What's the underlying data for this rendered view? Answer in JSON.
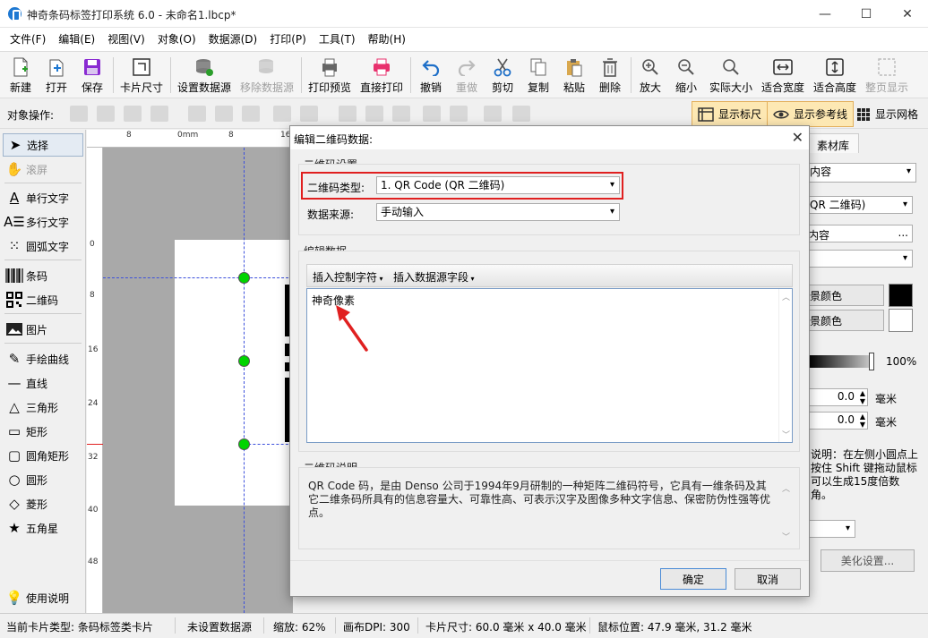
{
  "window": {
    "title": "神奇条码标签打印系统 6.0 - 未命名1.lbcp*",
    "controls": [
      "—",
      "☐",
      "✕"
    ]
  },
  "menu": [
    "文件(F)",
    "编辑(E)",
    "视图(V)",
    "对象(O)",
    "数据源(D)",
    "打印(P)",
    "工具(T)",
    "帮助(H)"
  ],
  "toolbar": {
    "new": "新建",
    "open": "打开",
    "save": "保存",
    "card_size": "卡片尺寸",
    "set_ds": "设置数据源",
    "remove_ds": "移除数据源",
    "print_preview": "打印预览",
    "print": "直接打印",
    "undo": "撤销",
    "redo": "重做",
    "cut": "剪切",
    "copy": "复制",
    "paste": "粘贴",
    "delete": "删除",
    "zoom_in": "放大",
    "zoom_out": "缩小",
    "actual": "实际大小",
    "fit_w": "适合宽度",
    "fit_h": "适合高度",
    "full": "整页显示"
  },
  "objbar": {
    "label": "对象操作:",
    "show_ruler": "显示标尺",
    "show_guides": "显示参考线",
    "show_grid": "显示网格"
  },
  "leftpanel": {
    "select": "选择",
    "scroll": "滚屏",
    "single_text": "单行文字",
    "multi_text": "多行文字",
    "arc_text": "圆弧文字",
    "barcode": "条码",
    "qrcode": "二维码",
    "image": "图片",
    "freehand": "手绘曲线",
    "line": "直线",
    "triangle": "三角形",
    "rect": "矩形",
    "round_rect": "圆角矩形",
    "circle": "圆形",
    "diamond": "菱形",
    "star": "五角星",
    "help": "使用说明"
  },
  "ruler": {
    "h": [
      "8",
      "0mm",
      "8",
      "16"
    ],
    "v": [
      "0",
      "8",
      "16",
      "24",
      "32",
      "40",
      "48"
    ]
  },
  "rightpanel": {
    "tab": "素材库",
    "content_combo": "内容",
    "qr_combo": "QR 二维码)",
    "content2": "内容",
    "more": "...",
    "bg_color": "景颜色",
    "fg_color": "景颜色",
    "opacity": "100%",
    "val1": "0.0",
    "val2": "0.0",
    "unit": "毫米",
    "tip": "说明：在左侧小圆点上按住 Shift 键拖动鼠标可以生成15度倍数角。",
    "beautify": "美化设置..."
  },
  "dialog": {
    "title": "编辑二维码数据:",
    "settings_group": "二维码设置",
    "type_label": "二维码类型:",
    "type_value": "1. QR Code (QR 二维码)",
    "source_label": "数据来源:",
    "source_value": "手动输入",
    "edit_group": "编辑数据",
    "insert_ctrl": "插入控制字符",
    "insert_field": "插入数据源字段",
    "data_text": "神奇像素",
    "desc_group": "二维码说明",
    "desc_text": "QR Code 码，是由 Denso 公司于1994年9月研制的一种矩阵二维码符号，它具有一维条码及其它二维条码所具有的信息容量大、可靠性高、可表示汉字及图像多种文字信息、保密防伪性强等优点。",
    "ok": "确定",
    "cancel": "取消"
  },
  "status": {
    "card_type": "当前卡片类型: 条码标签类卡片",
    "ds": "未设置数据源",
    "zoom": "缩放: 62%",
    "dpi": "画布DPI: 300",
    "size": "卡片尺寸: 60.0 毫米 x 40.0 毫米",
    "mouse": "鼠标位置: 47.9 毫米, 31.2 毫米"
  },
  "colors": {
    "accent_red": "#e02020",
    "selection": "#3c50dc",
    "handle": "#00d400"
  }
}
